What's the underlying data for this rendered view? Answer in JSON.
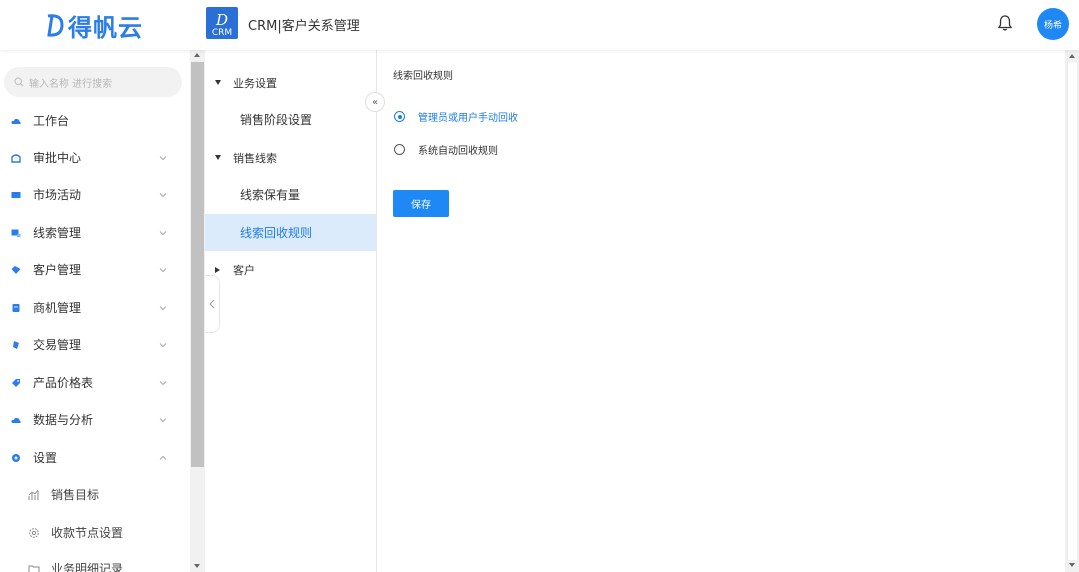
{
  "header": {
    "brand": "得帆云",
    "crm_logo_text": "CRM",
    "app_title": "CRM|客户关系管理",
    "avatar_text": "杨希"
  },
  "sidebar": {
    "search_placeholder": "输入名称 进行搜索",
    "items": [
      {
        "label": "工作台",
        "icon": "cloud-icon",
        "chevron": "none"
      },
      {
        "label": "审批中心",
        "icon": "approval-icon",
        "chevron": "down"
      },
      {
        "label": "市场活动",
        "icon": "market-icon",
        "chevron": "down"
      },
      {
        "label": "线索管理",
        "icon": "lead-icon",
        "chevron": "down"
      },
      {
        "label": "客户管理",
        "icon": "customer-icon",
        "chevron": "down"
      },
      {
        "label": "商机管理",
        "icon": "opportunity-icon",
        "chevron": "down"
      },
      {
        "label": "交易管理",
        "icon": "deal-icon",
        "chevron": "down"
      },
      {
        "label": "产品价格表",
        "icon": "price-icon",
        "chevron": "down"
      },
      {
        "label": "数据与分析",
        "icon": "analytics-icon",
        "chevron": "down"
      },
      {
        "label": "设置",
        "icon": "settings-icon",
        "chevron": "up"
      }
    ],
    "sub_items": [
      {
        "label": "销售目标",
        "icon": "chart-icon"
      },
      {
        "label": "收款节点设置",
        "icon": "gear-icon"
      },
      {
        "label": "业务明细记录",
        "icon": "folder-icon"
      }
    ]
  },
  "tree": {
    "nodes": [
      {
        "label": "业务设置",
        "expanded": true,
        "children": [
          "销售阶段设置"
        ]
      },
      {
        "label": "销售线索",
        "expanded": true,
        "children": [
          "线索保有量",
          "线索回收规则"
        ]
      },
      {
        "label": "客户",
        "expanded": false,
        "children": []
      }
    ],
    "active": "线索回收规则",
    "collapse_glyph": "«"
  },
  "content": {
    "title": "线索回收规则",
    "options": [
      {
        "label": "管理员或用户手动回收",
        "checked": true
      },
      {
        "label": "系统自动回收规则",
        "checked": false
      }
    ],
    "save_label": "保存"
  },
  "colors": {
    "accent": "#1e88f5",
    "active_bg": "#dcebfc",
    "active_text": "#1e7ce8"
  }
}
